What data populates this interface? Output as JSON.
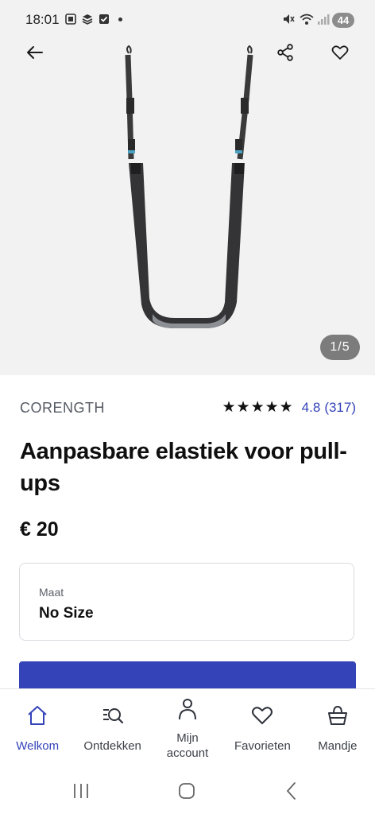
{
  "status_bar": {
    "time": "18:01",
    "battery": "44"
  },
  "gallery": {
    "counter": "1/5"
  },
  "product": {
    "brand": "CORENGTH",
    "stars": "★★★★★",
    "rating_value": "4.8",
    "rating_count": "(317)",
    "title": "Aanpasbare elastiek voor pull-ups",
    "price": "€ 20"
  },
  "size_selector": {
    "label": "Maat",
    "value": "No Size"
  },
  "nav": {
    "items": [
      {
        "label": "Welkom",
        "icon": "home-icon",
        "active": true
      },
      {
        "label": "Ontdekken",
        "icon": "discover-search-icon",
        "active": false
      },
      {
        "label": "Mijn account",
        "icon": "person-icon",
        "active": false
      },
      {
        "label": "Favorieten",
        "icon": "heart-icon",
        "active": false
      },
      {
        "label": "Mandje",
        "icon": "basket-icon",
        "active": false
      }
    ]
  },
  "colors": {
    "accent": "#3443b8",
    "hero_bg": "#f2f2f3",
    "text": "#0f0f0f"
  }
}
